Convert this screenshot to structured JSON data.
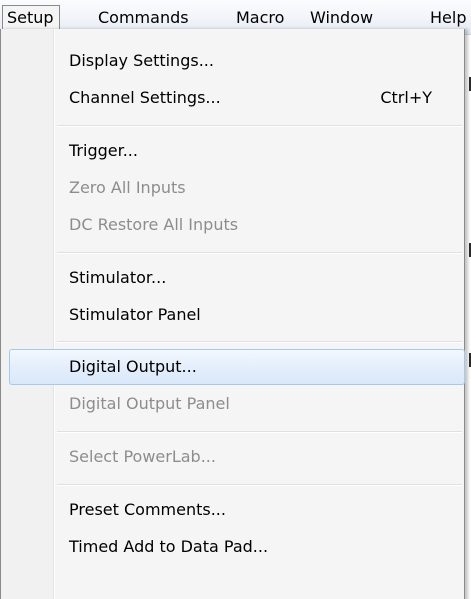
{
  "menubar": {
    "items": [
      {
        "label": "Setup",
        "open": true
      },
      {
        "label": "Commands"
      },
      {
        "label": "Macro"
      },
      {
        "label": "Window"
      },
      {
        "label": "Help"
      }
    ]
  },
  "dropdown": {
    "items": [
      {
        "label": "Display Settings...",
        "enabled": true
      },
      {
        "label": "Channel Settings...",
        "shortcut": "Ctrl+Y",
        "enabled": true
      },
      {
        "label": "Trigger...",
        "enabled": true
      },
      {
        "label": "Zero All Inputs",
        "enabled": false
      },
      {
        "label": "DC Restore All Inputs",
        "enabled": false
      },
      {
        "label": "Stimulator...",
        "enabled": true
      },
      {
        "label": "Stimulator Panel",
        "enabled": true
      },
      {
        "label": "Digital Output...",
        "enabled": true,
        "highlighted": true
      },
      {
        "label": "Digital Output Panel",
        "enabled": false
      },
      {
        "label": "Select PowerLab...",
        "enabled": false
      },
      {
        "label": "Preset Comments...",
        "enabled": true
      },
      {
        "label": "Timed Add to Data Pad...",
        "enabled": true
      }
    ]
  }
}
